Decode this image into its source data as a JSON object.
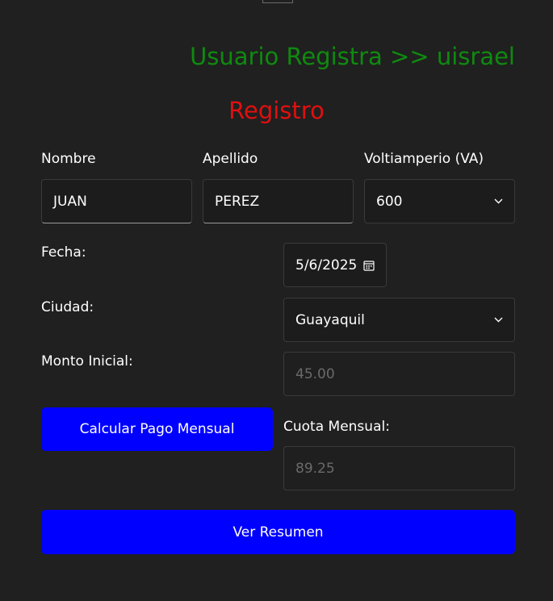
{
  "header": {
    "title": "Usuario Registra >> uisrael"
  },
  "form": {
    "title": "Registro",
    "nombre": {
      "label": "Nombre",
      "value": "JUAN"
    },
    "apellido": {
      "label": "Apellido",
      "value": "PEREZ"
    },
    "voltiamperio": {
      "label": "Voltiamperio (VA)",
      "value": "600"
    },
    "fecha": {
      "label": "Fecha:",
      "value": "5/6/2025"
    },
    "ciudad": {
      "label": "Ciudad:",
      "value": "Guayaquil"
    },
    "monto_inicial": {
      "label": "Monto Inicial:",
      "value": "45.00"
    },
    "cuota_mensual": {
      "label": "Cuota Mensual:",
      "value": "89.25"
    },
    "calcular_button": "Calcular Pago Mensual",
    "ver_resumen_button": "Ver Resumen"
  },
  "colors": {
    "background": "#202020",
    "header_title": "#0f8a0f",
    "form_title": "#e10f0f",
    "button": "#0000ff"
  },
  "icons": {
    "dropdown": "chevron-down-icon",
    "date_picker": "calendar-icon"
  }
}
